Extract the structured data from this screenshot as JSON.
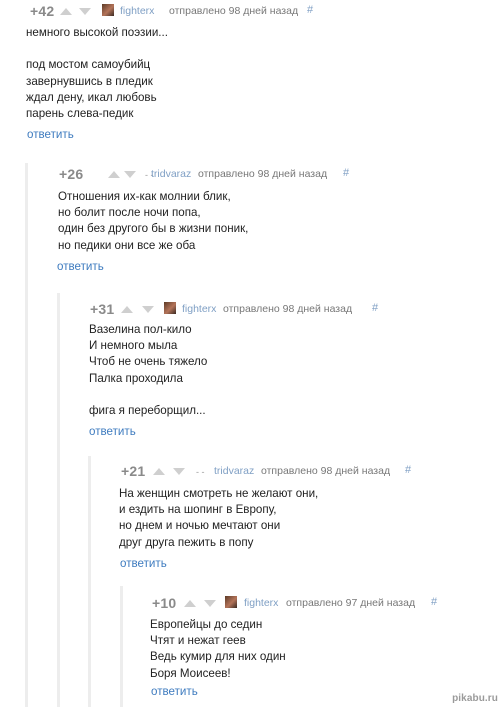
{
  "comments": [
    {
      "score": "+42",
      "author": "fighterx",
      "meta": "отправлено 98 дней назад",
      "link": "#",
      "text": "немного высокой поэзии...\n\nпод мостом самоубийц\nзавернувшись в пледик\nждал дену, икал любовь\nпарень слева-педик",
      "reply": "ответить",
      "avatar": "photo"
    },
    {
      "score": "+26",
      "author": "tridvaraz",
      "meta": "отправлено 98 дней назад",
      "link": "#",
      "text": "Отношения их-как молнии блик,\nно болит после ночи попа,\nодин без другого бы в жизни поник,\nно педики они все же оба",
      "reply": "ответить",
      "avatar": "none"
    },
    {
      "score": "+31",
      "author": "fighterx",
      "meta": "отправлено 98 дней назад",
      "link": "#",
      "text": "Вазелина пол-кило\nИ немного мыла\nЧтоб не очень тяжело\nПалка проходила\n\nфига я переборщил...",
      "reply": "ответить",
      "avatar": "photo"
    },
    {
      "score": "+21",
      "author": "tridvaraz",
      "meta": "отправлено 98 дней назад",
      "link": "#",
      "text": "На женщин смотреть не желают они,\nи ездить на шопинг в Европу,\nно днем и ночью мечтают они\nдруг друга пежить в попу",
      "reply": "ответить",
      "avatar": "none"
    },
    {
      "score": "+10",
      "author": "fighterx",
      "meta": "отправлено 97 дней назад",
      "link": "#",
      "text": "Европейцы до седин\nЧтят и нежат геев\nВедь кумир для них один\nБоря Моисеев!",
      "reply": "ответить",
      "avatar": "photo"
    }
  ],
  "watermark": "pikabu.ru"
}
